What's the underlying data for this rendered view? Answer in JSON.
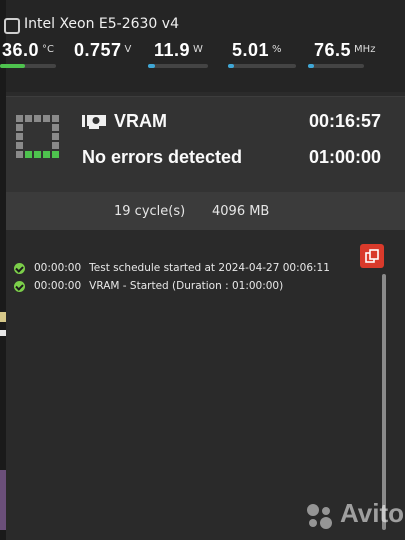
{
  "header": {
    "cpu_name": "Intel Xeon E5-2630 v4",
    "metrics": [
      {
        "value": "36.0",
        "unit": "°C",
        "level": 0.45,
        "color": "#4ec24e"
      },
      {
        "value": "0.757",
        "unit": "V"
      },
      {
        "value": "11.9",
        "unit": "W",
        "level": 0.12,
        "color": "#3fa7d6"
      },
      {
        "value": "5.01",
        "unit": "%",
        "level": 0.05,
        "color": "#3fa7d6"
      },
      {
        "value": "76.5",
        "unit": "MHz",
        "level": 0.04,
        "color": "#3fa7d6"
      }
    ]
  },
  "test": {
    "name": "VRAM",
    "status": "No errors detected",
    "elapsed": "00:16:57",
    "duration": "01:00:00",
    "progress_cells_done": 4,
    "progress_cells_total": 16,
    "done_color": "#4ec24e"
  },
  "info": {
    "cycles": "19 cycle(s)",
    "size": "4096 MB"
  },
  "log": {
    "entries": [
      {
        "time": "00:00:00",
        "message": "Test schedule started at 2024-04-27 00:06:11"
      },
      {
        "time": "00:00:00",
        "message": "VRAM - Started (Duration : 01:00:00)"
      }
    ],
    "copy_icon": "copy-icon",
    "accent": "#d93a2b"
  },
  "watermark": {
    "text": "Avito"
  }
}
